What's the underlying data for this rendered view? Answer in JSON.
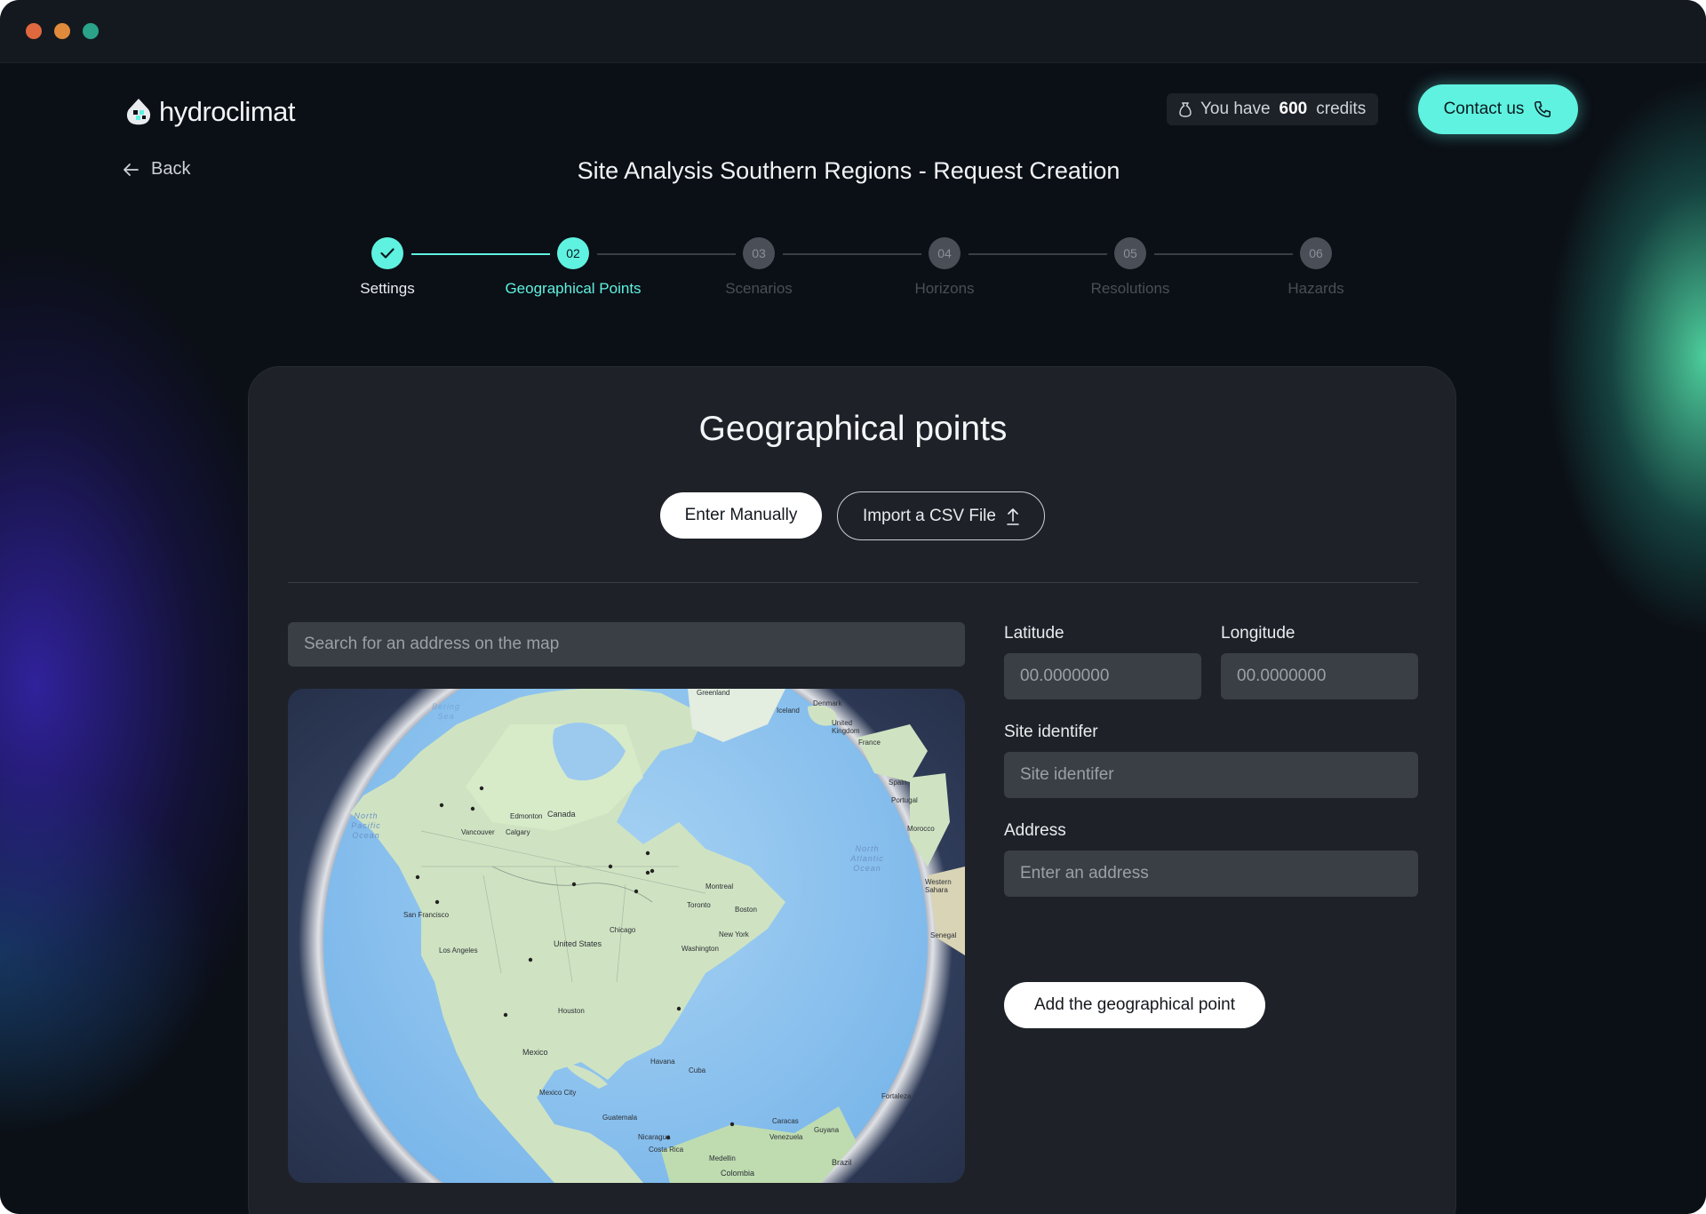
{
  "brand": {
    "name": "hydroclimat"
  },
  "header": {
    "credits_prefix": "You have",
    "credits_amount": "600",
    "credits_suffix": "credits",
    "contact_label": "Contact us",
    "back_label": "Back",
    "title": "Site Analysis Southern Regions - Request Creation"
  },
  "stepper": {
    "steps": [
      {
        "number": "",
        "label": "Settings",
        "state": "done"
      },
      {
        "number": "02",
        "label": "Geographical Points",
        "state": "active"
      },
      {
        "number": "03",
        "label": "Scenarios",
        "state": "upcoming"
      },
      {
        "number": "04",
        "label": "Horizons",
        "state": "upcoming"
      },
      {
        "number": "05",
        "label": "Resolutions",
        "state": "upcoming"
      },
      {
        "number": "06",
        "label": "Hazards",
        "state": "upcoming"
      }
    ]
  },
  "card": {
    "title": "Geographical points",
    "mode_manual": "Enter Manually",
    "mode_csv": "Import a CSV File"
  },
  "map": {
    "search_placeholder": "Search for an address on the map",
    "labels": {
      "greenland": "Greenland",
      "iceland": "Iceland",
      "denmark": "Denmark",
      "uk": "United Kingdom",
      "france": "France",
      "spain": "Spain",
      "portugal": "Portugal",
      "morocco": "Morocco",
      "western_sahara": "Western Sahara",
      "senegal": "Senegal",
      "canada": "Canada",
      "edmonton": "Edmonton",
      "calgary": "Calgary",
      "vancouver": "Vancouver",
      "san_francisco": "San Francisco",
      "los_angeles": "Los Angeles",
      "united_states": "United States",
      "chicago": "Chicago",
      "toronto": "Toronto",
      "montreal": "Montreal",
      "boston": "Boston",
      "new_york": "New York",
      "washington": "Washington",
      "houston": "Houston",
      "mexico": "Mexico",
      "mexico_city": "Mexico City",
      "havana": "Havana",
      "cuba": "Cuba",
      "guatemala": "Guatemala",
      "nicaragua": "Nicaragua",
      "costa_rica": "Costa Rica",
      "caracas": "Caracas",
      "venezuela": "Venezuela",
      "guyana": "Guyana",
      "medellin": "Medellin",
      "colombia": "Colombia",
      "brazil": "Brazil",
      "fortaleza": "Fortaleza",
      "north_pacific": "North Pacific Ocean",
      "north_atlantic": "North Atlantic Ocean",
      "bering_sea": "Bering Sea"
    }
  },
  "form": {
    "latitude_label": "Latitude",
    "latitude_placeholder": "00.0000000",
    "longitude_label": "Longitude",
    "longitude_placeholder": "00.0000000",
    "site_label": "Site identifer",
    "site_placeholder": "Site identifer",
    "address_label": "Address",
    "address_placeholder": "Enter an address",
    "submit_label": "Add the geographical point"
  },
  "colors": {
    "accent": "#5ff2e0",
    "background": "#0b0f16",
    "card": "#1e2228",
    "input": "#3a3e45"
  }
}
